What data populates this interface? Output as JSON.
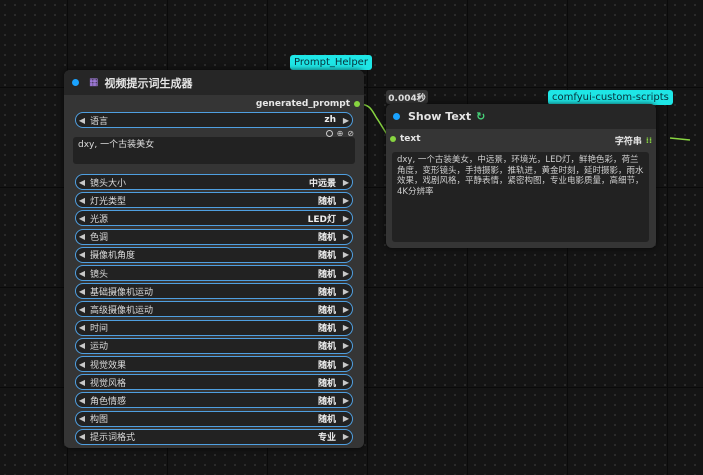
{
  "node1": {
    "badge": "Prompt_Helper",
    "title": "视频提示词生成器",
    "output_label": "generated_prompt",
    "language_label": "语言",
    "language_value": "zh",
    "prompt_text": "dxy, 一个古装美女",
    "widgets": [
      {
        "label": "镜头大小",
        "value": "中远景"
      },
      {
        "label": "灯光类型",
        "value": "随机"
      },
      {
        "label": "光源",
        "value": "LED灯"
      },
      {
        "label": "色调",
        "value": "随机"
      },
      {
        "label": "摄像机角度",
        "value": "随机"
      },
      {
        "label": "镜头",
        "value": "随机"
      },
      {
        "label": "基础摄像机运动",
        "value": "随机"
      },
      {
        "label": "高级摄像机运动",
        "value": "随机"
      },
      {
        "label": "时间",
        "value": "随机"
      },
      {
        "label": "运动",
        "value": "随机"
      },
      {
        "label": "视觉效果",
        "value": "随机"
      },
      {
        "label": "视觉风格",
        "value": "随机"
      },
      {
        "label": "角色情感",
        "value": "随机"
      },
      {
        "label": "构图",
        "value": "随机"
      },
      {
        "label": "提示词格式",
        "value": "专业"
      }
    ]
  },
  "node2": {
    "badge": "comfyui-custom-scripts",
    "timing": "0.004秒",
    "title": "Show Text",
    "input_label": "text",
    "output_label": "字符串",
    "text": "dxy, 一个古装美女，中远景，环境光，LED灯，鲜艳色彩，荷兰角度，变形镜头，手持摄影，推轨进，黄金时刻，延时摄影，雨水效果，戏剧风格，平静表情，紧密构图，专业电影质量，高细节，4K分辨率"
  },
  "colors": {
    "badge": "#1ee6e6",
    "widget_border": "#4f9fe0",
    "link_wire": "#87d440",
    "node_dot": "#1aa3ff"
  }
}
